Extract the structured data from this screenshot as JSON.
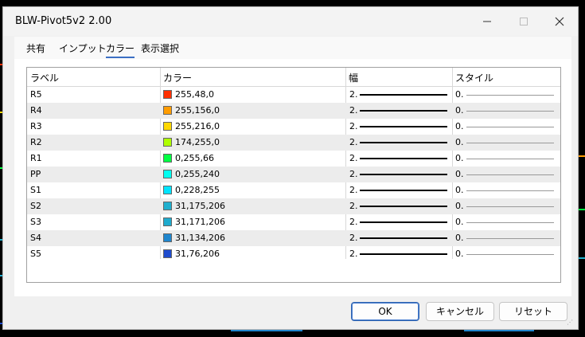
{
  "window": {
    "title": "BLW-Pivot5v2 2.00"
  },
  "tabs": [
    {
      "label": "共有"
    },
    {
      "label": "インプット"
    },
    {
      "label": "カラー"
    },
    {
      "label": "表示選択"
    }
  ],
  "columns": {
    "label": "ラベル",
    "color": "カラー",
    "width": "幅",
    "style": "スタイル"
  },
  "rows": [
    {
      "label": "R5",
      "color": "255,48,0",
      "swatch": "#ff3000",
      "width": "2.",
      "style": "0."
    },
    {
      "label": "R4",
      "color": "255,156,0",
      "swatch": "#ff9c00",
      "width": "2.",
      "style": "0."
    },
    {
      "label": "R3",
      "color": "255,216,0",
      "swatch": "#ffd800",
      "width": "2.",
      "style": "0."
    },
    {
      "label": "R2",
      "color": "174,255,0",
      "swatch": "#aeff00",
      "width": "2.",
      "style": "0."
    },
    {
      "label": "R1",
      "color": "0,255,66",
      "swatch": "#00ff42",
      "width": "2.",
      "style": "0."
    },
    {
      "label": "PP",
      "color": "0,255,240",
      "swatch": "#00fff0",
      "width": "2.",
      "style": "0."
    },
    {
      "label": "S1",
      "color": "0,228,255",
      "swatch": "#00e4ff",
      "width": "2.",
      "style": "0."
    },
    {
      "label": "S2",
      "color": "31,175,206",
      "swatch": "#1fafce",
      "width": "2.",
      "style": "0."
    },
    {
      "label": "S3",
      "color": "31,171,206",
      "swatch": "#1fabce",
      "width": "2.",
      "style": "0."
    },
    {
      "label": "S4",
      "color": "31,134,206",
      "swatch": "#1f86ce",
      "width": "2.",
      "style": "0."
    },
    {
      "label": "S5",
      "color": "31,76,206",
      "swatch": "#1f4cce",
      "width": "2.",
      "style": "0."
    }
  ],
  "buttons": {
    "ok": "OK",
    "cancel": "キャンセル",
    "reset": "リセット"
  },
  "icons": {
    "minimize": "minimize-icon",
    "maximize": "maximize-icon",
    "close": "close-icon",
    "grip": "resize-grip-icon"
  }
}
